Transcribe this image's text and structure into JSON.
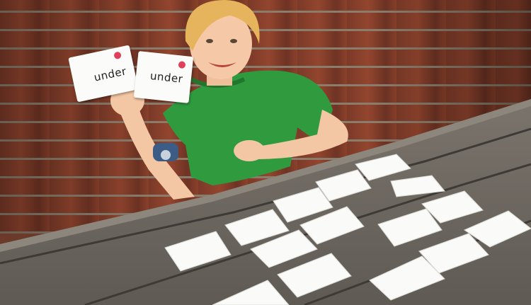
{
  "photo": {
    "subject": "child-with-flashcards",
    "colors": {
      "brick": "#8c412b",
      "mortar": "#8a7d6c",
      "table_wood": "#6f6a63",
      "shirt": "#2f9a3e",
      "card": "#fbfbf9",
      "card_logo": "#e0405a"
    }
  },
  "held_cards": [
    {
      "word": "under"
    },
    {
      "word": "under"
    }
  ]
}
